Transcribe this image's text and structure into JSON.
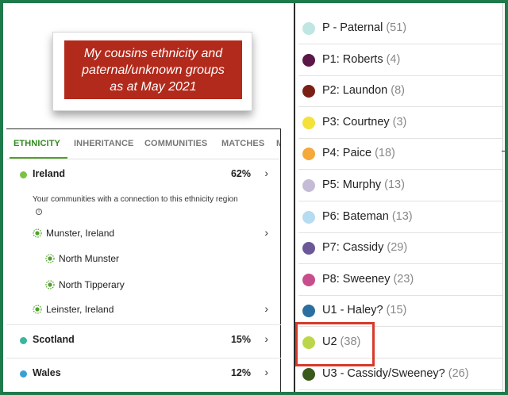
{
  "title": {
    "lines": [
      "My cousins ethnicity and",
      "paternal/unknown groups",
      "as at May 2021"
    ]
  },
  "tabs": [
    "ETHNICITY",
    "INHERITANCE",
    "COMMUNITIES",
    "MATCHES",
    "M"
  ],
  "ethnicity": {
    "regions": [
      {
        "name": "Ireland",
        "percent": "62%",
        "color": "#7cc242"
      },
      {
        "name": "Scotland",
        "percent": "15%",
        "color": "#3cb5a0"
      },
      {
        "name": "Wales",
        "percent": "12%",
        "color": "#3a9fd6"
      }
    ],
    "note": "Your communities with a connection to this ethnicity region",
    "communities": [
      {
        "name": "Munster, Ireland",
        "level": 1
      },
      {
        "name": "North Munster",
        "level": 2
      },
      {
        "name": "North Tipperary",
        "level": 2
      },
      {
        "name": "Leinster, Ireland",
        "level": 1
      }
    ]
  },
  "groups": [
    {
      "label": "P - Paternal",
      "count": "(51)",
      "color": "#bfe6e2"
    },
    {
      "label": "P1: Roberts",
      "count": "(4)",
      "color": "#5a1748"
    },
    {
      "label": "P2: Laundon",
      "count": "(8)",
      "color": "#7b1f15"
    },
    {
      "label": "P3: Courtney",
      "count": "(3)",
      "color": "#f4e13a"
    },
    {
      "label": "P4: Paice",
      "count": "(18)",
      "color": "#f4a93a"
    },
    {
      "label": "P5: Murphy",
      "count": "(13)",
      "color": "#c4bcd6"
    },
    {
      "label": "P6: Bateman",
      "count": "(13)",
      "color": "#b5dcf0"
    },
    {
      "label": "P7: Cassidy",
      "count": "(29)",
      "color": "#6a5898"
    },
    {
      "label": "P8: Sweeney",
      "count": "(23)",
      "color": "#c84d8c"
    },
    {
      "label": "U1 - Haley?",
      "count": "(15)",
      "color": "#2a6fa0"
    },
    {
      "label": "U2",
      "count": "(38)",
      "color": "#bcd64c"
    },
    {
      "label": "U3 - Cassidy/Sweeney?",
      "count": "(26)",
      "color": "#3a5a1c"
    }
  ]
}
